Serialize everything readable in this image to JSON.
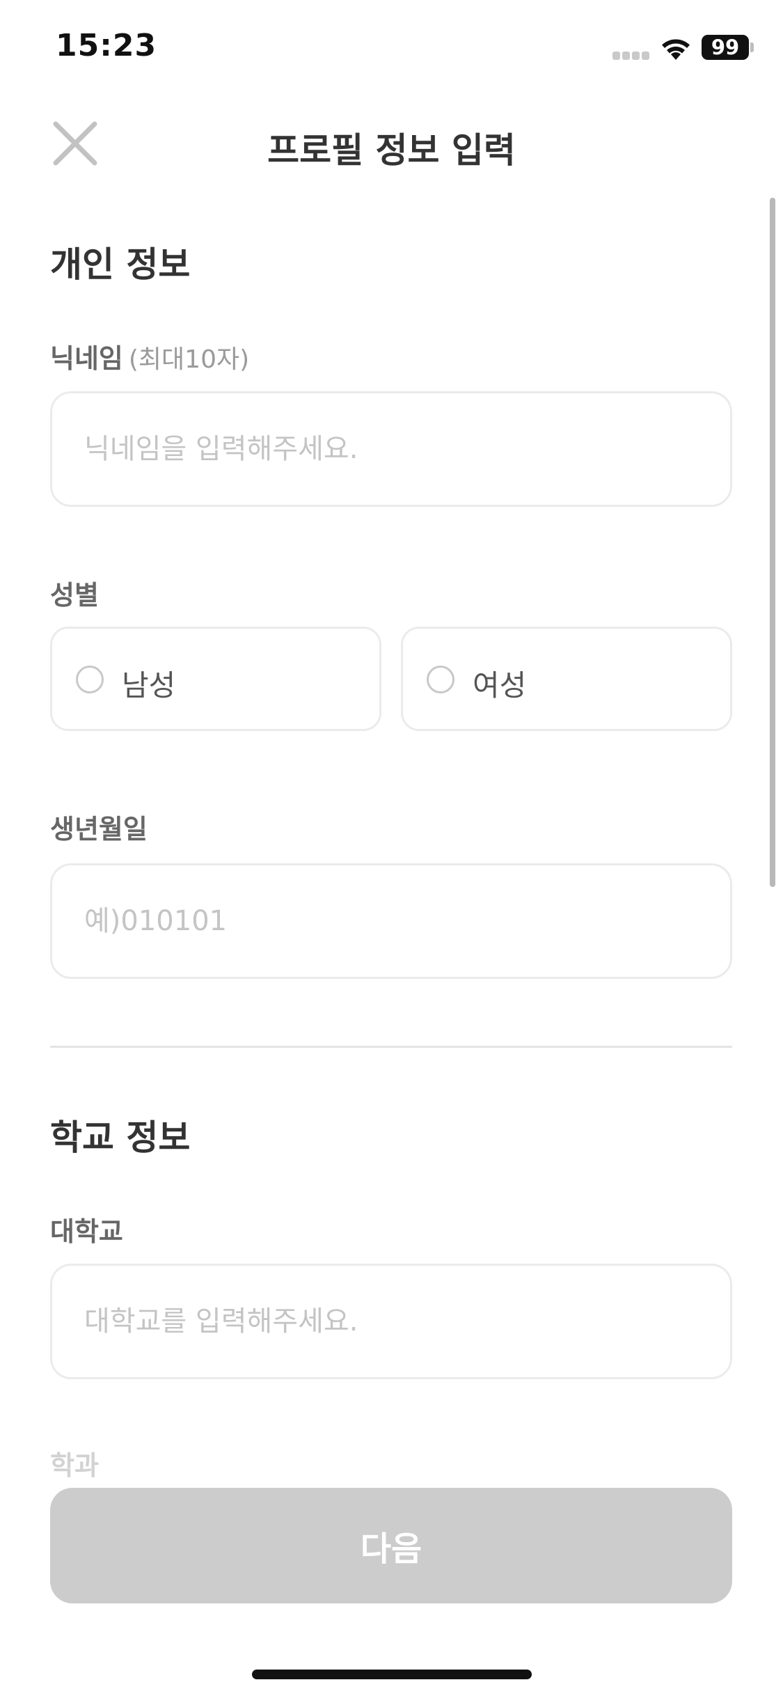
{
  "status_bar": {
    "time": "15:23",
    "battery": "99"
  },
  "header": {
    "title": "프로필 정보 입력"
  },
  "personal": {
    "section_title": "개인 정보",
    "nickname": {
      "label": "닉네임",
      "hint": "(최대10자)",
      "placeholder": "닉네임을 입력해주세요."
    },
    "gender": {
      "label": "성별",
      "options": [
        "남성",
        "여성"
      ]
    },
    "birthdate": {
      "label": "생년월일",
      "placeholder": "예)010101"
    }
  },
  "school": {
    "section_title": "학교 정보",
    "university": {
      "label": "대학교",
      "placeholder": "대학교를 입력해주세요."
    },
    "department": {
      "label": "학과"
    }
  },
  "footer": {
    "next_label": "다음"
  },
  "colors": {
    "disabled_button": "#cccccc",
    "input_border": "#ebebeb",
    "placeholder": "#c4c4c4"
  }
}
